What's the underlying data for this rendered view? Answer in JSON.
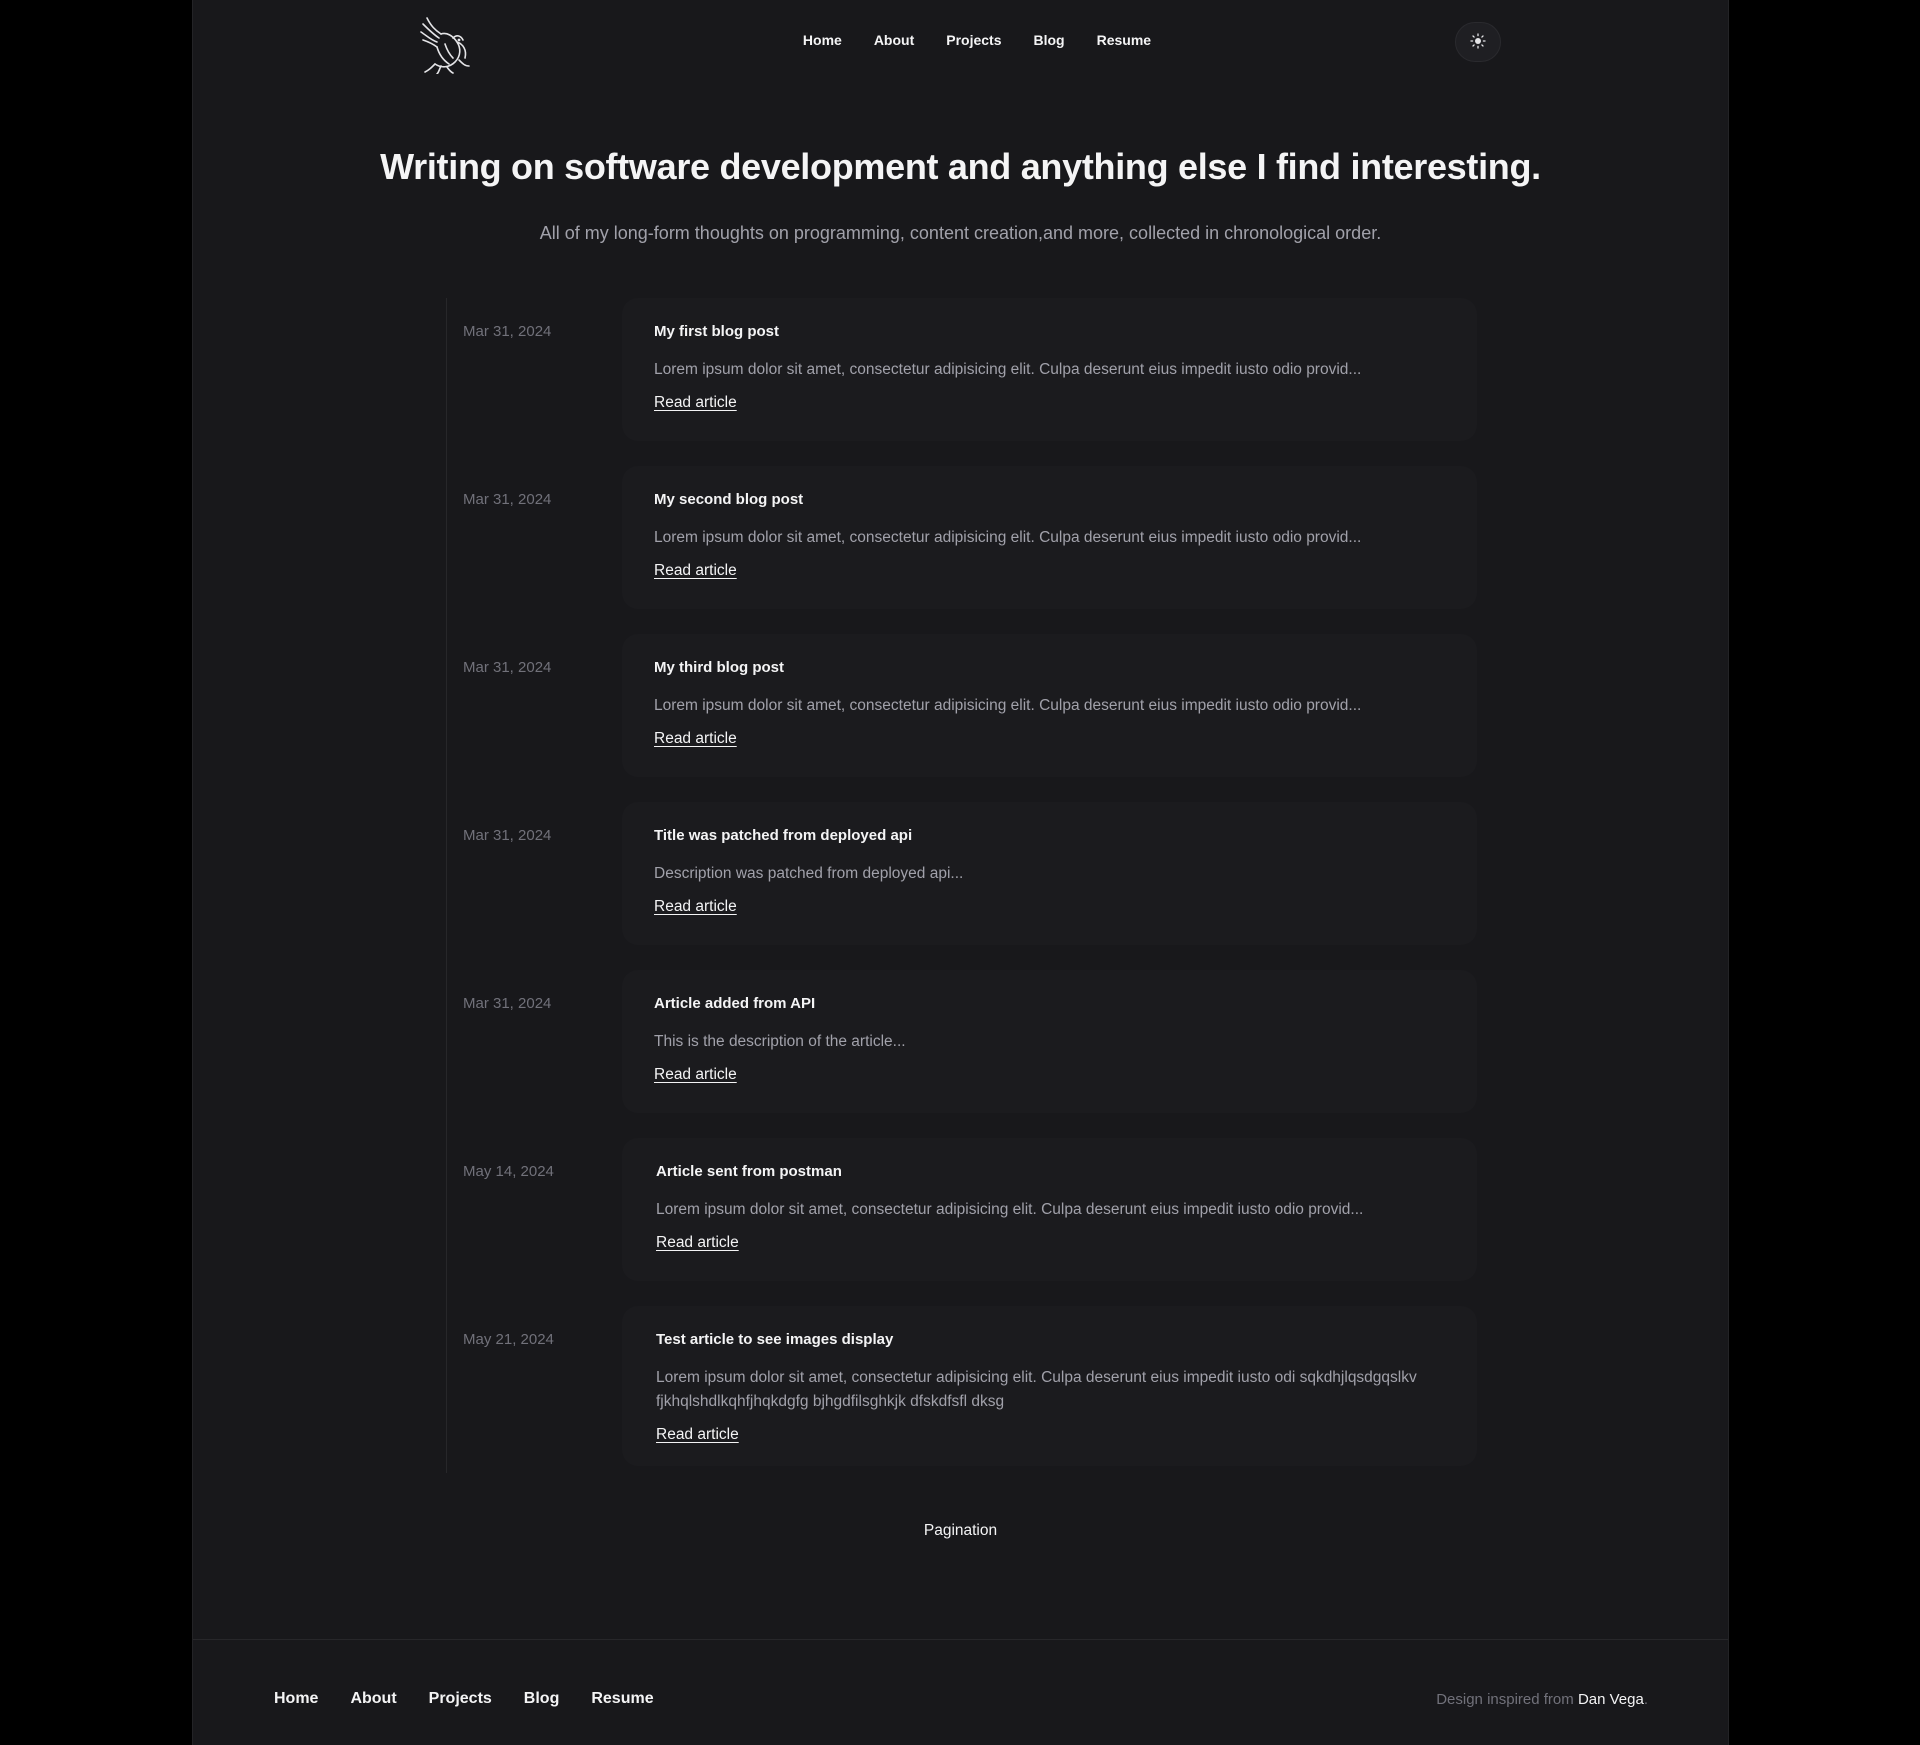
{
  "nav": {
    "items": [
      "Home",
      "About",
      "Projects",
      "Blog",
      "Resume"
    ]
  },
  "theme_toggle": {
    "icon": "sun-icon"
  },
  "hero": {
    "title": "Writing on software development and anything else I find interesting.",
    "subtitle": "All of my long-form thoughts on programming, content creation,and more, collected in chronological order."
  },
  "articles": [
    {
      "date": "Mar 31, 2024",
      "title": "My first blog post",
      "description": "Lorem ipsum dolor sit amet, consectetur adipisicing elit. Culpa deserunt eius impedit iusto odio provid...",
      "link_label": "Read article"
    },
    {
      "date": "Mar 31, 2024",
      "title": "My second blog post",
      "description": "Lorem ipsum dolor sit amet, consectetur adipisicing elit. Culpa deserunt eius impedit iusto odio provid...",
      "link_label": "Read article"
    },
    {
      "date": "Mar 31, 2024",
      "title": "My third blog post",
      "description": "Lorem ipsum dolor sit amet, consectetur adipisicing elit. Culpa deserunt eius impedit iusto odio provid...",
      "link_label": "Read article"
    },
    {
      "date": "Mar 31, 2024",
      "title": "Title was patched from deployed api",
      "description": "Description was patched from deployed api...",
      "link_label": "Read article"
    },
    {
      "date": "Mar 31, 2024",
      "title": "Article added from API",
      "description": "This is the description of the article...",
      "link_label": "Read article"
    },
    {
      "date": "May 14, 2024",
      "title": "Article sent from postman",
      "description": "Lorem ipsum dolor sit amet, consectetur adipisicing elit. Culpa deserunt eius impedit iusto odio provid...",
      "link_label": "Read article"
    },
    {
      "date": "May 21, 2024",
      "title": "Test article to see images display",
      "description": "Lorem ipsum dolor sit amet, consectetur adipisicing elit. Culpa deserunt eius impedit iusto odi sqkdhjlqsdgqslkv fjkhqlshdlkqhfjhqkdgfg bjhgdfilsghkjk dfskdfsfl dksg",
      "link_label": "Read article"
    }
  ],
  "pagination": {
    "label": "Pagination"
  },
  "footer": {
    "nav": [
      "Home",
      "About",
      "Projects",
      "Blog",
      "Resume"
    ],
    "credit_prefix": "Design inspired from ",
    "credit_name": "Dan Vega",
    "credit_suffix": "."
  },
  "colors": {
    "page_background": "#18181b",
    "outer_background": "#000000",
    "text_primary": "#f4f4f5",
    "text_muted": "#a1a1aa",
    "text_date": "#71717a"
  }
}
